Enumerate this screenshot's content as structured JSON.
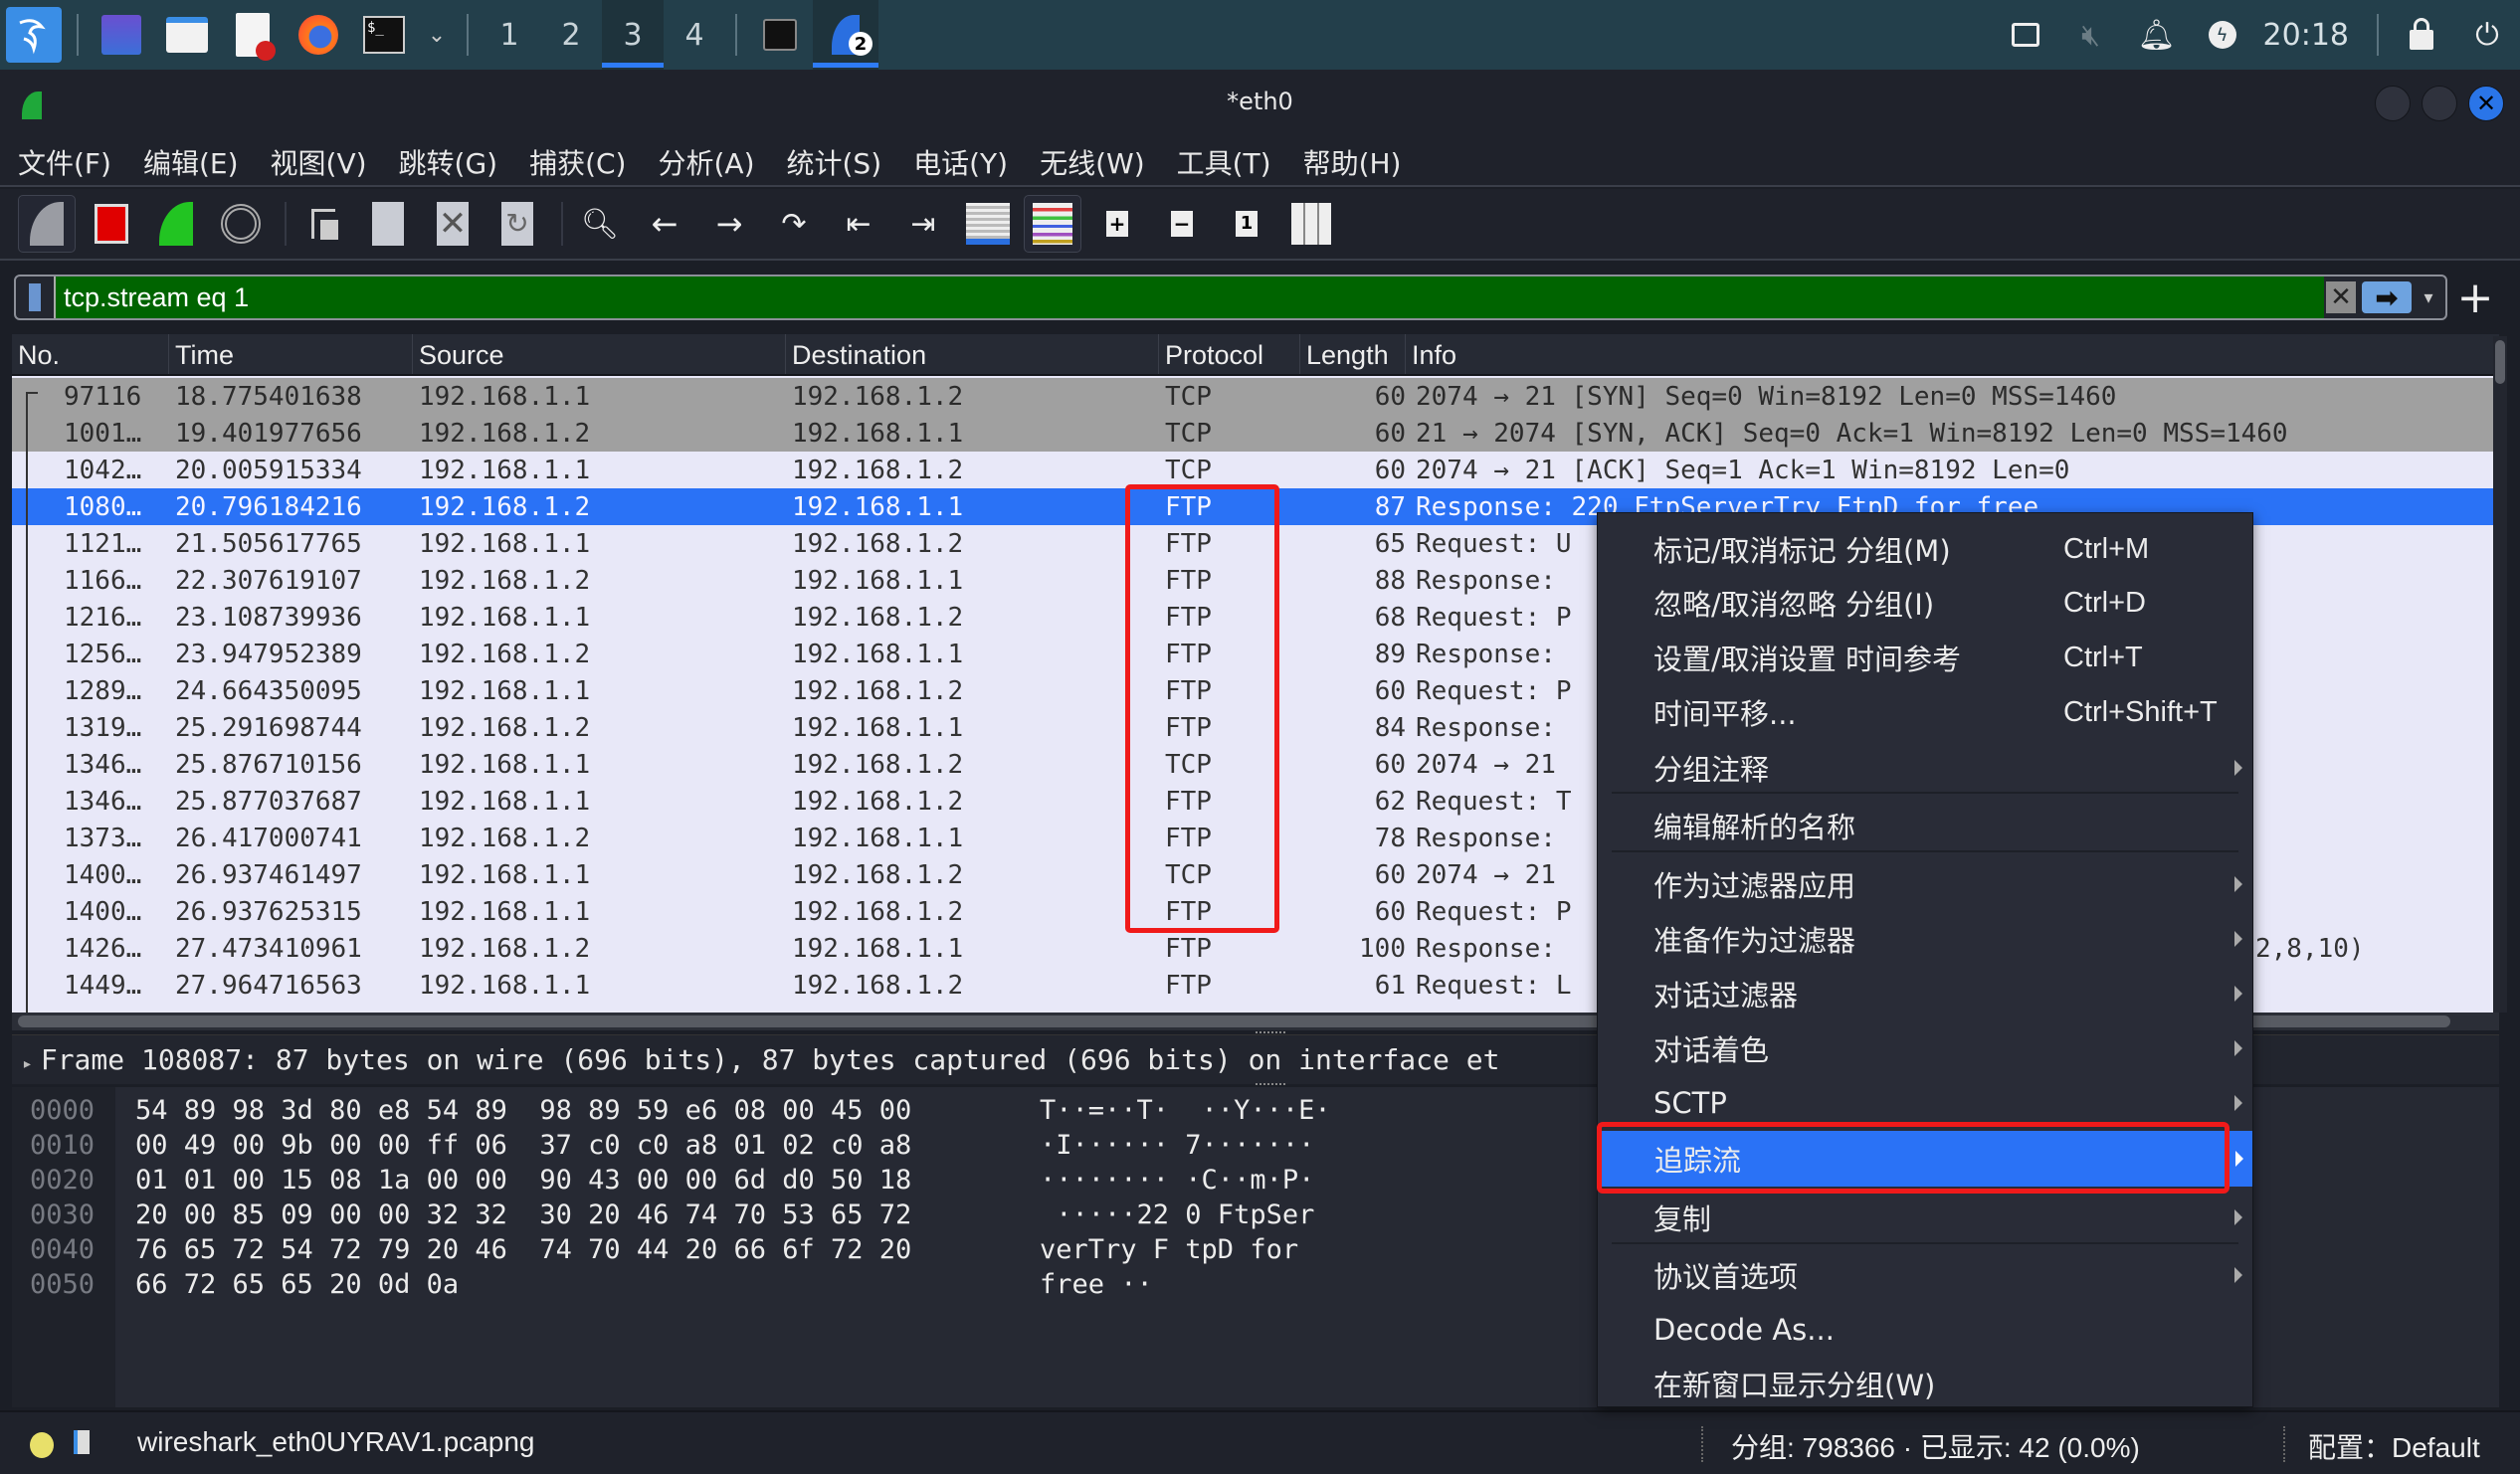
{
  "taskbar": {
    "workspaces": [
      "1",
      "2",
      "3",
      "4"
    ],
    "active_workspace": "3",
    "app_badge": "2",
    "clock": "20:18",
    "icons": [
      "kali-menu-icon",
      "desktop-icon",
      "file-manager-icon",
      "text-editor-icon",
      "firefox-icon",
      "terminal-icon",
      "chevron-down-icon",
      "terminal-window-icon",
      "wireshark-app-icon",
      "network-icon",
      "mute-icon",
      "notification-bell-icon",
      "power-icon",
      "lock-icon",
      "logout-icon"
    ]
  },
  "window": {
    "title": "*eth0"
  },
  "menubar": {
    "items": [
      "文件(F)",
      "编辑(E)",
      "视图(V)",
      "跳转(G)",
      "捕获(C)",
      "分析(A)",
      "统计(S)",
      "电话(Y)",
      "无线(W)",
      "工具(T)",
      "帮助(H)"
    ]
  },
  "toolbar": {
    "buttons": [
      "start-capture",
      "stop-capture",
      "restart-capture",
      "capture-options",
      "open-file",
      "save-file",
      "close-file",
      "reload-file",
      "find-packet",
      "go-back",
      "go-forward",
      "go-to-packet",
      "go-first",
      "go-last",
      "auto-scroll",
      "colorize",
      "zoom-in",
      "zoom-out",
      "normal-size",
      "resize-columns"
    ]
  },
  "filter": {
    "value": "tcp.stream eq 1",
    "colors": {
      "valid": "#006400"
    }
  },
  "packet_list": {
    "columns": [
      "No.",
      "Time",
      "Source",
      "Destination",
      "Protocol",
      "Length",
      "Info"
    ],
    "rows": [
      {
        "no": "97116",
        "time": "18.775401638",
        "src": "192.168.1.1",
        "dst": "192.168.1.2",
        "proto": "TCP",
        "len": "60",
        "info": "2074 → 21 [SYN] Seq=0 Win=8192 Len=0 MSS=1460",
        "style": "grey"
      },
      {
        "no": "1001…",
        "time": "19.401977656",
        "src": "192.168.1.2",
        "dst": "192.168.1.1",
        "proto": "TCP",
        "len": "60",
        "info": "21 → 2074 [SYN, ACK] Seq=0 Ack=1 Win=8192 Len=0 MSS=1460",
        "style": "grey"
      },
      {
        "no": "1042…",
        "time": "20.005915334",
        "src": "192.168.1.1",
        "dst": "192.168.1.2",
        "proto": "TCP",
        "len": "60",
        "info": "2074 → 21 [ACK] Seq=1 Ack=1 Win=8192 Len=0",
        "style": "normal"
      },
      {
        "no": "1080…",
        "time": "20.796184216",
        "src": "192.168.1.2",
        "dst": "192.168.1.1",
        "proto": "FTP",
        "len": "87",
        "info": "Response: 220 FtpServerTry FtpD for free",
        "style": "selected"
      },
      {
        "no": "1121…",
        "time": "21.505617765",
        "src": "192.168.1.1",
        "dst": "192.168.1.2",
        "proto": "FTP",
        "len": "65",
        "info": "Request: U",
        "style": "normal"
      },
      {
        "no": "1166…",
        "time": "22.307619107",
        "src": "192.168.1.2",
        "dst": "192.168.1.1",
        "proto": "FTP",
        "len": "88",
        "info": "Response:",
        "style": "normal"
      },
      {
        "no": "1216…",
        "time": "23.108739936",
        "src": "192.168.1.1",
        "dst": "192.168.1.2",
        "proto": "FTP",
        "len": "68",
        "info": "Request: P",
        "style": "normal"
      },
      {
        "no": "1256…",
        "time": "23.947952389",
        "src": "192.168.1.2",
        "dst": "192.168.1.1",
        "proto": "FTP",
        "len": "89",
        "info": "Response:",
        "style": "normal"
      },
      {
        "no": "1289…",
        "time": "24.664350095",
        "src": "192.168.1.1",
        "dst": "192.168.1.2",
        "proto": "FTP",
        "len": "60",
        "info": "Request: P",
        "style": "normal"
      },
      {
        "no": "1319…",
        "time": "25.291698744",
        "src": "192.168.1.2",
        "dst": "192.168.1.1",
        "proto": "FTP",
        "len": "84",
        "info": "Response:",
        "style": "normal"
      },
      {
        "no": "1346…",
        "time": "25.876710156",
        "src": "192.168.1.1",
        "dst": "192.168.1.2",
        "proto": "TCP",
        "len": "60",
        "info": "2074 → 21",
        "style": "normal"
      },
      {
        "no": "1346…",
        "time": "25.877037687",
        "src": "192.168.1.1",
        "dst": "192.168.1.2",
        "proto": "FTP",
        "len": "62",
        "info": "Request: T",
        "style": "normal"
      },
      {
        "no": "1373…",
        "time": "26.417000741",
        "src": "192.168.1.2",
        "dst": "192.168.1.1",
        "proto": "FTP",
        "len": "78",
        "info": "Response:",
        "style": "normal"
      },
      {
        "no": "1400…",
        "time": "26.937461497",
        "src": "192.168.1.1",
        "dst": "192.168.1.2",
        "proto": "TCP",
        "len": "60",
        "info": "2074 → 21",
        "style": "normal"
      },
      {
        "no": "1400…",
        "time": "26.937625315",
        "src": "192.168.1.1",
        "dst": "192.168.1.2",
        "proto": "FTP",
        "len": "60",
        "info": "Request: P",
        "style": "normal"
      },
      {
        "no": "1426…",
        "time": "27.473410961",
        "src": "192.168.1.2",
        "dst": "192.168.1.1",
        "proto": "FTP",
        "len": "100",
        "info": "Response:",
        "info_tail": "2,8,10)",
        "style": "normal"
      },
      {
        "no": "1449…",
        "time": "27.964716563",
        "src": "192.168.1.1",
        "dst": "192.168.1.2",
        "proto": "FTP",
        "len": "61",
        "info": "Request: L",
        "style": "normal"
      }
    ],
    "row_colors": {
      "grey": "#a0a0a0",
      "normal": "#e7e6fa",
      "selected": "#2a72f6"
    }
  },
  "detail": {
    "frame_summary": "Frame 108087: 87 bytes on wire (696 bits), 87 bytes captured (696 bits) on interface et"
  },
  "hex_dump": [
    {
      "offset": "0000",
      "bytes": "54 89 98 3d 80 e8 54 89  98 89 59 e6 08 00 45 00",
      "ascii": "T··=··T·  ··Y···E·"
    },
    {
      "offset": "0010",
      "bytes": "00 49 00 9b 00 00 ff 06  37 c0 c0 a8 01 02 c0 a8",
      "ascii": "·I······ 7·······"
    },
    {
      "offset": "0020",
      "bytes": "01 01 00 15 08 1a 00 00  90 43 00 00 6d d0 50 18",
      "ascii": "········ ·C··m·P·"
    },
    {
      "offset": "0030",
      "bytes": "20 00 85 09 00 00 32 32  30 20 46 74 70 53 65 72",
      "ascii": " ·····22 0 FtpSer"
    },
    {
      "offset": "0040",
      "bytes": "76 65 72 54 72 79 20 46  74 70 44 20 66 6f 72 20",
      "ascii": "verTry F tpD for "
    },
    {
      "offset": "0050",
      "bytes": "66 72 65 65 20 0d 0a",
      "ascii": "free ··"
    }
  ],
  "status": {
    "file": "wireshark_eth0UYRAV1.pcapng",
    "packets": "分组: 798366 · 已显示: 42 (0.0%)",
    "profile": "配置：Default"
  },
  "context_menu": {
    "items": [
      {
        "label": "标记/取消标记 分组(M)",
        "shortcut": "Ctrl+M",
        "submenu": false
      },
      {
        "label": "忽略/取消忽略 分组(I)",
        "shortcut": "Ctrl+D",
        "submenu": false
      },
      {
        "label": "设置/取消设置 时间参考",
        "shortcut": "Ctrl+T",
        "submenu": false
      },
      {
        "label": "时间平移...",
        "shortcut": "Ctrl+Shift+T",
        "submenu": false
      },
      {
        "label": "分组注释",
        "shortcut": "",
        "submenu": true
      },
      {
        "label": "编辑解析的名称",
        "shortcut": "",
        "submenu": false
      },
      {
        "label": "作为过滤器应用",
        "shortcut": "",
        "submenu": true
      },
      {
        "label": "准备作为过滤器",
        "shortcut": "",
        "submenu": true
      },
      {
        "label": "对话过滤器",
        "shortcut": "",
        "submenu": true
      },
      {
        "label": "对话着色",
        "shortcut": "",
        "submenu": true
      },
      {
        "label": "SCTP",
        "shortcut": "",
        "submenu": true
      },
      {
        "label": "追踪流",
        "shortcut": "",
        "submenu": true,
        "highlighted": true
      },
      {
        "label": "复制",
        "shortcut": "",
        "submenu": true
      },
      {
        "label": "协议首选项",
        "shortcut": "",
        "submenu": true
      },
      {
        "label": "Decode As...",
        "shortcut": "",
        "submenu": false
      },
      {
        "label": "在新窗口显示分组(W)",
        "shortcut": "",
        "submenu": false
      }
    ]
  },
  "annotations": {
    "highlight_color": "#f01a1a",
    "boxes": [
      "protocol-column-ftp-rows",
      "follow-stream-menu-item"
    ]
  }
}
